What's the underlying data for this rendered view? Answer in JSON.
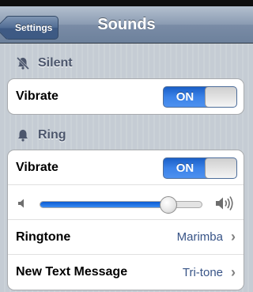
{
  "navbar": {
    "back_label": "Settings",
    "title": "Sounds"
  },
  "sections": {
    "silent": {
      "header": "Silent",
      "vibrate": {
        "label": "Vibrate",
        "toggle": "ON"
      }
    },
    "ring": {
      "header": "Ring",
      "vibrate": {
        "label": "Vibrate",
        "toggle": "ON"
      },
      "volume": {
        "level": 0.8
      },
      "ringtone": {
        "label": "Ringtone",
        "value": "Marimba"
      },
      "text_message": {
        "label": "New Text Message",
        "value": "Tri-tone"
      }
    }
  },
  "icons": [
    "silent-bell-icon",
    "bell-icon",
    "volume-low-icon",
    "volume-high-icon",
    "chevron-right-icon"
  ],
  "colors": {
    "accent": "#2f74dd",
    "value_text": "#385487",
    "background": "#c5ccd4"
  }
}
